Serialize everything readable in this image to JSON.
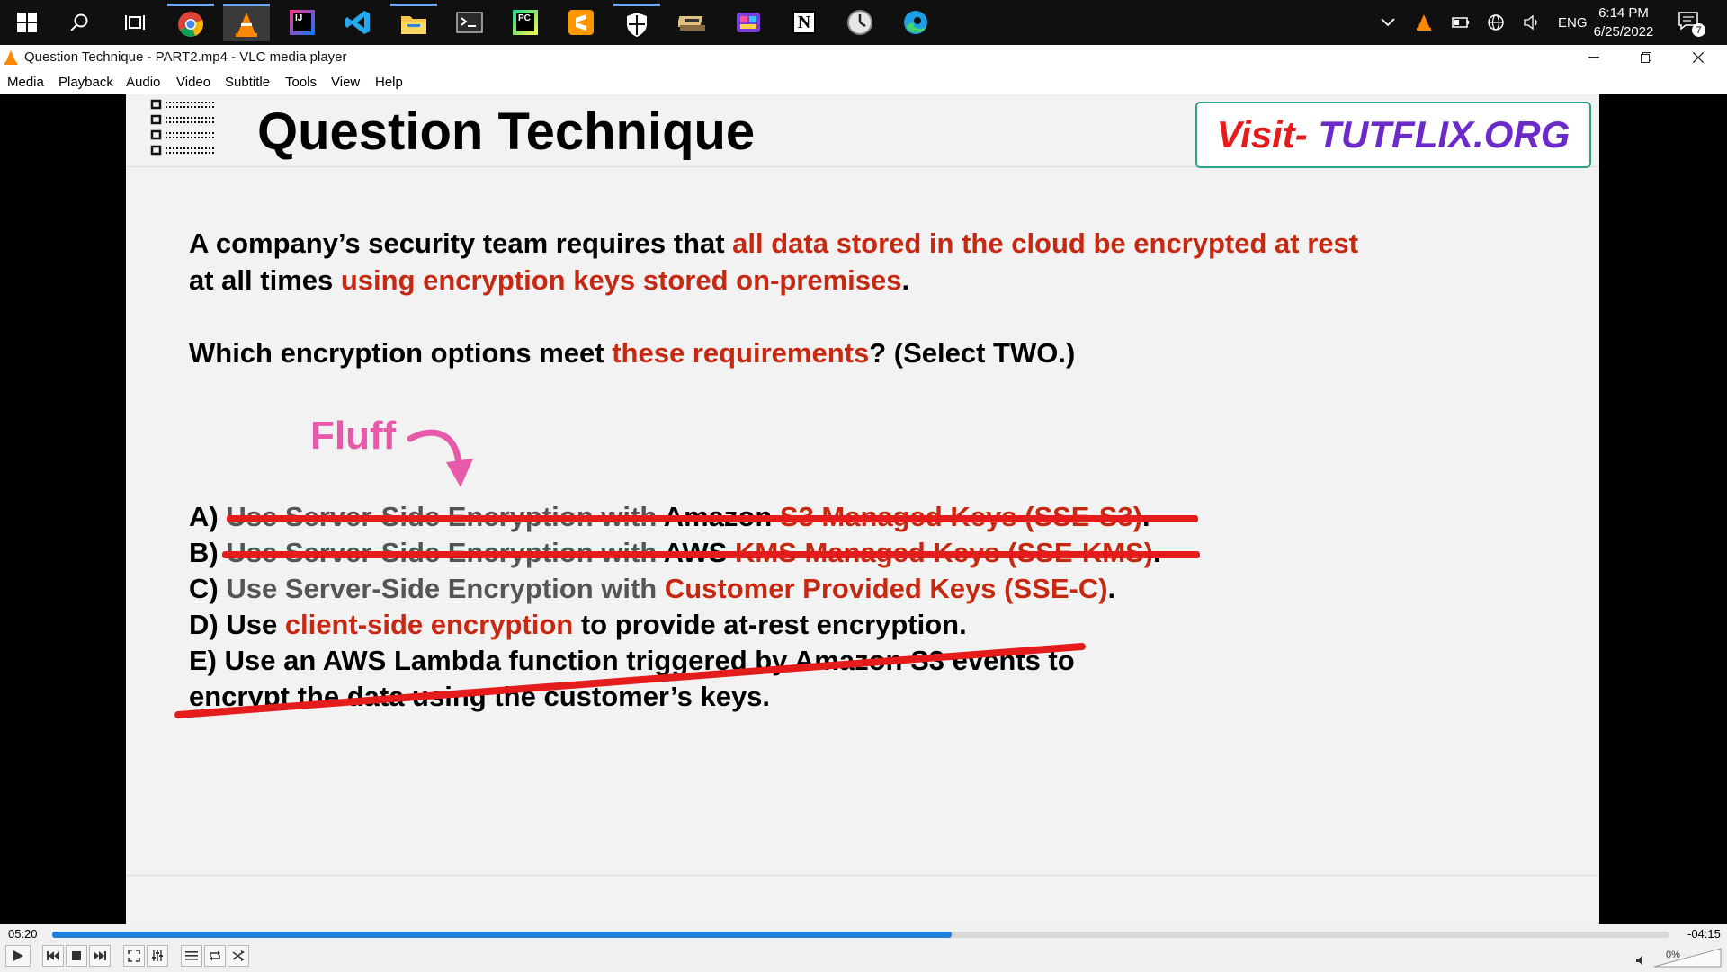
{
  "taskbar": {
    "pinned": [
      {
        "name": "start-icon"
      },
      {
        "name": "search-icon"
      },
      {
        "name": "task-view-icon"
      },
      {
        "name": "chrome-icon"
      },
      {
        "name": "vlc-icon"
      },
      {
        "name": "intellij-icon",
        "text": "IJ"
      },
      {
        "name": "vscode-icon"
      },
      {
        "name": "file-explorer-icon"
      },
      {
        "name": "terminal-icon"
      },
      {
        "name": "pycharm-icon",
        "text": "PC"
      },
      {
        "name": "sublime-icon"
      },
      {
        "name": "security-icon"
      },
      {
        "name": "app-icon"
      },
      {
        "name": "media-app-icon"
      },
      {
        "name": "notion-icon",
        "text": "N"
      },
      {
        "name": "clock-app-icon"
      },
      {
        "name": "edge-icon"
      }
    ],
    "tray": {
      "language": "ENG"
    },
    "clock": {
      "time": "6:14 PM",
      "date": "6/25/2022"
    },
    "notifications": {
      "count": "7"
    }
  },
  "window": {
    "title": "Question Technique - PART2.mp4 - VLC media player",
    "menu": [
      "Media",
      "Playback",
      "Audio",
      "Video",
      "Subtitle",
      "Tools",
      "View",
      "Help"
    ]
  },
  "slide": {
    "title": "Question Technique",
    "visit_prefix": "Visit- ",
    "visit_site": "TUTFLIX.ORG",
    "question": {
      "line1_plain": "A company’s security team requires that ",
      "line1_red": "all data stored in the cloud be encrypted at rest",
      "line2_plain": "at all times ",
      "line2_red": "using encryption keys stored on-premises",
      "line2_end": ".",
      "line3_plain": "Which encryption options meet ",
      "line3_red": "these requirements",
      "line3_end": "? (Select TWO.)"
    },
    "annotation": "Fluff",
    "options": {
      "a": {
        "label": "A)",
        "grey": "Use Server-Side Encryption with ",
        "black": "Amazon ",
        "red": "S3 Managed Keys (SSE-S3)",
        "end": "."
      },
      "b": {
        "label": "B)",
        "grey": "Use Server-Side Encryption with ",
        "black": "AWS ",
        "red": "KMS Managed Keys (SSE-KMS)",
        "end": "."
      },
      "c": {
        "label": "C) ",
        "grey": "Use Server-Side Encryption with ",
        "red": "Customer Provided Keys (SSE-C)",
        "end": "."
      },
      "d": {
        "label": "D) Use ",
        "red": "client-side encryption",
        "end": " to provide at-rest encryption."
      },
      "e": {
        "line1": "E) Use an AWS Lambda function triggered by Amazon S3 events to",
        "line2": "encrypt the data using the customer’s keys."
      }
    }
  },
  "player": {
    "elapsed": "05:20",
    "remaining": "-04:15",
    "progress_fraction": 0.556,
    "volume": "0%",
    "accent": "#1e7fd8"
  },
  "colors": {
    "emphasis_red": "#c62912",
    "strike_red": "#e41c1c",
    "fluff_pink": "#e75aa9",
    "visit_purple": "#6c2bc9",
    "visit_border": "#2aa38a"
  }
}
